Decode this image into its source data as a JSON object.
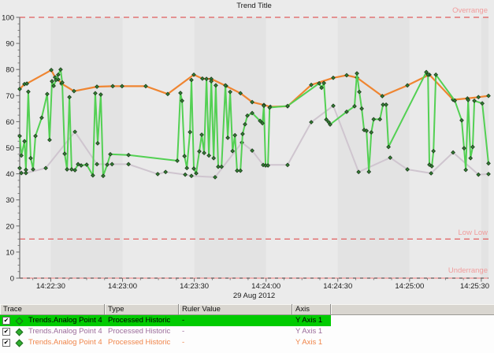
{
  "title": "Trend Title",
  "chart_data": {
    "type": "line",
    "title": "Trend Title",
    "xlabel": "",
    "ylabel": "",
    "ylim": [
      0,
      100
    ],
    "y_major_ticks": [
      0,
      10,
      20,
      30,
      40,
      50,
      60,
      70,
      80,
      90,
      100
    ],
    "y_minor_step": 2.5,
    "x_tick_labels": [
      "14:22:30",
      "14:23:00",
      "14:23:30",
      "14:24:00",
      "14:24:30",
      "14:25:00",
      "14:25:30"
    ],
    "x_tick_times_s": [
      13,
      43,
      73,
      103,
      133,
      163,
      193
    ],
    "x_minor_step_s": 7.5,
    "x_range_s": [
      0,
      196
    ],
    "date_label": "29 Aug 2012",
    "grid": "off",
    "legend": "table-below",
    "band_colors": [
      "#eaeaea",
      "#e3e3e3"
    ],
    "threshold_line_color": "#e05e5e",
    "threshold_label_color": "#f19c9c",
    "baseline_colors": {
      "salmon": "#f0a0a0",
      "gray_dash": "#787878"
    },
    "axis_color": "#6a6a6a",
    "marker": {
      "shape": "diamond",
      "fill": "#357f35",
      "stroke": "#1b3d1b"
    },
    "thresholds": [
      {
        "label": "Overrange",
        "value": 100,
        "style": "dashed"
      },
      {
        "label": "Low Low",
        "value": 15,
        "style": "dashed"
      },
      {
        "label": "Underrange",
        "value": 0,
        "style": "baseline"
      }
    ],
    "draw_order": [
      1,
      2,
      0
    ],
    "series": [
      {
        "name": "Trends.Analog Point 4",
        "color": "#53d053",
        "width": 2,
        "points": [
          [
            0,
            54.5
          ],
          [
            0.7,
            47
          ],
          [
            2,
            52.5
          ],
          [
            2.6,
            41.5
          ],
          [
            3.6,
            71.5
          ],
          [
            4.6,
            46
          ],
          [
            5.6,
            41.7
          ],
          [
            6.6,
            54.5
          ],
          [
            9.2,
            61.5
          ],
          [
            11.5,
            70.6
          ],
          [
            12.5,
            53
          ],
          [
            13.5,
            75.5
          ],
          [
            14.2,
            73.7
          ],
          [
            15.2,
            76
          ],
          [
            16.1,
            78
          ],
          [
            17.1,
            80
          ],
          [
            17.8,
            75
          ],
          [
            18.8,
            47.7
          ],
          [
            19.8,
            41.7
          ],
          [
            20.8,
            69.4
          ],
          [
            21.7,
            41.7
          ],
          [
            23.1,
            41.4
          ],
          [
            24.4,
            43.7
          ],
          [
            25.7,
            43.2
          ],
          [
            28,
            43.5
          ],
          [
            30.6,
            39.4
          ],
          [
            31.6,
            70.9
          ],
          [
            32.6,
            51.7
          ],
          [
            33.9,
            70.4
          ],
          [
            34.9,
            39.2
          ],
          [
            36.6,
            43.5
          ],
          [
            37.9,
            47.5
          ],
          [
            45.5,
            47.2
          ],
          [
            65.9,
            45
          ],
          [
            67.2,
            71
          ],
          [
            67.9,
            68
          ],
          [
            68.9,
            46.8
          ],
          [
            69.9,
            42.2
          ],
          [
            71.2,
            56
          ],
          [
            71.8,
            76
          ],
          [
            72.8,
            42
          ],
          [
            73.8,
            40.2
          ],
          [
            75.1,
            48.6
          ],
          [
            76.1,
            55
          ],
          [
            77.1,
            48
          ],
          [
            78.1,
            76.4
          ],
          [
            79.1,
            47
          ],
          [
            80.1,
            75.5
          ],
          [
            81.1,
            46
          ],
          [
            82,
            73.9
          ],
          [
            83,
            42.7
          ],
          [
            84.4,
            42.7
          ],
          [
            86,
            73.9
          ],
          [
            87,
            53.8
          ],
          [
            88,
            71.4
          ],
          [
            89,
            48.7
          ],
          [
            90,
            54.8
          ],
          [
            90.9,
            41.2
          ],
          [
            92.3,
            41.2
          ],
          [
            93.2,
            55.3
          ],
          [
            94.2,
            59
          ],
          [
            95.2,
            62.3
          ],
          [
            97.2,
            63.3
          ],
          [
            100.5,
            60.3
          ],
          [
            101.5,
            59.4
          ],
          [
            102.1,
            66.1
          ],
          [
            102.8,
            43.2
          ],
          [
            103.8,
            43.2
          ],
          [
            104.5,
            65.4
          ],
          [
            112,
            66
          ],
          [
            125.2,
            74.7
          ],
          [
            126.2,
            73
          ],
          [
            127.2,
            74.8
          ],
          [
            128.2,
            60.8
          ],
          [
            129.2,
            59.8
          ],
          [
            129.8,
            58.9
          ],
          [
            136.7,
            63.8
          ],
          [
            140,
            65.9
          ],
          [
            141,
            78.5
          ],
          [
            142,
            71.4
          ],
          [
            143,
            65
          ],
          [
            144,
            56.8
          ],
          [
            145,
            56.5
          ],
          [
            146,
            40.8
          ],
          [
            147,
            55.9
          ],
          [
            148,
            60.9
          ],
          [
            150.6,
            60.9
          ],
          [
            151.9,
            66.5
          ],
          [
            153.2,
            66.5
          ],
          [
            154.2,
            50.3
          ],
          [
            170,
            79
          ],
          [
            170.7,
            78
          ],
          [
            171.3,
            43.5
          ],
          [
            172.3,
            42.9
          ],
          [
            173,
            48.7
          ],
          [
            174,
            78
          ],
          [
            181.9,
            68.1
          ],
          [
            184.8,
            60.5
          ],
          [
            185.8,
            49.8
          ],
          [
            186.5,
            41.5
          ],
          [
            187.5,
            68.3
          ],
          [
            188.5,
            46
          ],
          [
            189.4,
            50.3
          ],
          [
            190.1,
            68
          ],
          [
            193.4,
            67
          ],
          [
            196,
            44
          ]
        ]
      },
      {
        "name": "Trends.Analog Point 4",
        "color": "#cfc5cf",
        "width": 2,
        "points": [
          [
            0,
            42.2
          ],
          [
            0.7,
            40.3
          ],
          [
            2.6,
            40.3
          ],
          [
            10.9,
            42.2
          ],
          [
            23.1,
            56.1
          ],
          [
            32.3,
            43.7
          ],
          [
            38.6,
            43.7
          ],
          [
            45.5,
            43.7
          ],
          [
            57.7,
            39.9
          ],
          [
            61,
            40.7
          ],
          [
            69.2,
            39.7
          ],
          [
            71.8,
            39.2
          ],
          [
            81.7,
            38.7
          ],
          [
            92.9,
            52
          ],
          [
            97.2,
            48.9
          ],
          [
            101.8,
            43.4
          ],
          [
            112,
            43.4
          ],
          [
            121.9,
            59.8
          ],
          [
            131.1,
            66.1
          ],
          [
            141.7,
            40.7
          ],
          [
            154.9,
            46.2
          ],
          [
            162.1,
            41.7
          ],
          [
            172,
            40.2
          ],
          [
            181.2,
            48.2
          ],
          [
            191.8,
            39.7
          ],
          [
            196,
            39.9
          ]
        ]
      },
      {
        "name": "Trends.Analog Point 4",
        "color": "#ef8531",
        "width": 2.2,
        "points": [
          [
            0,
            72.5
          ],
          [
            2,
            74.4
          ],
          [
            3,
            74.6
          ],
          [
            13.2,
            79.8
          ],
          [
            14.8,
            77
          ],
          [
            16.1,
            76.2
          ],
          [
            17.5,
            74.6
          ],
          [
            22.7,
            71.7
          ],
          [
            32.3,
            73.4
          ],
          [
            38.9,
            73.6
          ],
          [
            42.8,
            73.6
          ],
          [
            52.7,
            73.6
          ],
          [
            61.9,
            70.6
          ],
          [
            72.8,
            78
          ],
          [
            76.4,
            76.5
          ],
          [
            80.1,
            76.4
          ],
          [
            86.3,
            73.7
          ],
          [
            92.3,
            70.9
          ],
          [
            97.2,
            67.5
          ],
          [
            102.1,
            66.4
          ],
          [
            104.8,
            65.7
          ],
          [
            112,
            65.9
          ],
          [
            121.9,
            74.1
          ],
          [
            131.1,
            76.8
          ],
          [
            136.7,
            77.8
          ],
          [
            141,
            76.9
          ],
          [
            151.6,
            69.8
          ],
          [
            162.1,
            73.9
          ],
          [
            171.3,
            78
          ],
          [
            181.2,
            68.4
          ],
          [
            187.2,
            68.9
          ],
          [
            191.8,
            69.4
          ],
          [
            196,
            69.9
          ]
        ]
      }
    ]
  },
  "table": {
    "headers": [
      "Trace",
      "Type",
      "Ruler Value",
      "Axis"
    ],
    "check_glyph": "✔",
    "selected_row_bg": "#00cb00",
    "rows": [
      {
        "checked": true,
        "trace": "Trends.Analog Point 4",
        "type": "Processed Historic",
        "ruler_value": "-",
        "axis": "Y Axis 1",
        "text_color": "#000000",
        "selected": true,
        "marker_style": "open"
      },
      {
        "checked": true,
        "trace": "Trends.Analog Point 4",
        "type": "Processed Historic",
        "ruler_value": "-",
        "axis": "Y Axis 1",
        "text_color": "#9b6d9b",
        "selected": false,
        "marker_style": "filled"
      },
      {
        "checked": true,
        "trace": "Trends.Analog Point 4",
        "type": "Processed Historic",
        "ruler_value": "-",
        "axis": "Y Axis 1",
        "text_color": "#f0854a",
        "selected": false,
        "marker_style": "filled"
      }
    ]
  }
}
